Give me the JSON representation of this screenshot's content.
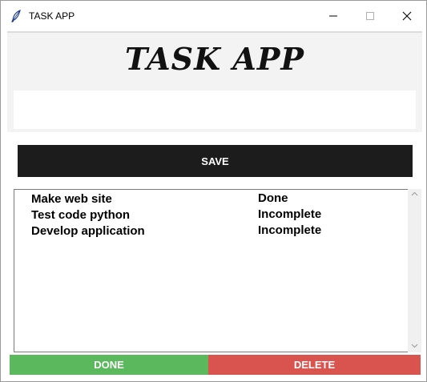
{
  "window": {
    "title": "TASK APP"
  },
  "header": {
    "title": "TASK APP"
  },
  "task_input": {
    "value": "",
    "placeholder": ""
  },
  "buttons": {
    "save_label": "SAVE",
    "done_label": "DONE",
    "delete_label": "DELETE"
  },
  "tasks": [
    {
      "name": "Make web site",
      "status": "Done"
    },
    {
      "name": "Test code python",
      "status": "Incomplete"
    },
    {
      "name": "Develop application",
      "status": "Incomplete"
    }
  ],
  "colors": {
    "save_bg": "#1c1c1c",
    "done_bg": "#5cb85c",
    "delete_bg": "#d9534f",
    "header_bg": "#f4f3f4"
  },
  "icons": {
    "app_icon": "feather-icon",
    "minimize": "minimize-icon",
    "maximize": "maximize-icon",
    "close": "close-icon",
    "scroll_up": "chevron-up-icon",
    "scroll_down": "chevron-down-icon"
  }
}
